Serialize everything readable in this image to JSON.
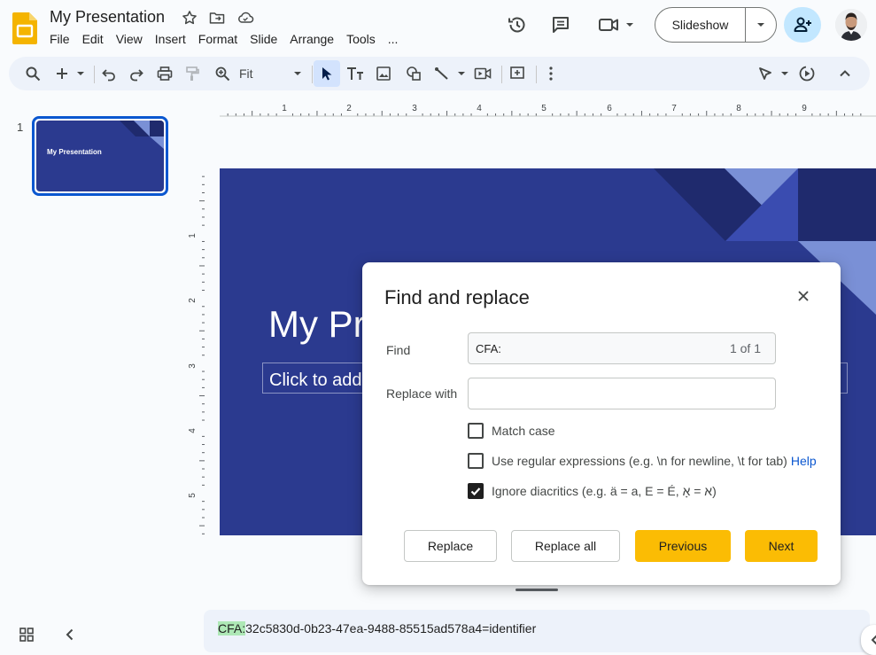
{
  "app": {
    "doc_title": "My Presentation"
  },
  "menu": [
    "File",
    "Edit",
    "View",
    "Insert",
    "Format",
    "Slide",
    "Arrange",
    "Tools",
    "..."
  ],
  "header": {
    "slideshow_label": "Slideshow"
  },
  "toolbar": {
    "zoom_value": "Fit"
  },
  "ruler": {
    "horizontal_ticks": [
      "1",
      "2",
      "3",
      "4",
      "5",
      "6",
      "7",
      "8",
      "9"
    ],
    "vertical_ticks": [
      "1",
      "2",
      "3",
      "4",
      "5"
    ]
  },
  "filmstrip": {
    "slide_number": "1",
    "thumb_title": "My Presentation"
  },
  "slide": {
    "title": "My Presentation",
    "subtitle": "Click to add subtitle"
  },
  "find_replace": {
    "title": "Find and replace",
    "find_label": "Find",
    "find_value": "CFA:",
    "match_count": "1 of 1",
    "replace_label": "Replace with",
    "replace_value": "",
    "options": [
      {
        "label": "Match case",
        "checked": false
      },
      {
        "label": "Use regular expressions (e.g. \\n for newline, \\t for tab)",
        "checked": false
      },
      {
        "label": "Ignore diacritics (e.g. ä = a, E = É, א = אָ)",
        "checked": true
      }
    ],
    "help_link": "Help",
    "buttons": {
      "replace": "Replace",
      "replace_all": "Replace all",
      "previous": "Previous",
      "next": "Next"
    }
  },
  "speaker_notes": {
    "highlight": "CFA:",
    "rest": "32c5830d-0b23-47ea-9488-85515ad578a4=identifier"
  },
  "colors": {
    "accent_blue": "#0b57d0",
    "slide_bg": "#2b3a8f",
    "primary_button": "#fbbc04",
    "find_highlight": "#aee8b6"
  }
}
